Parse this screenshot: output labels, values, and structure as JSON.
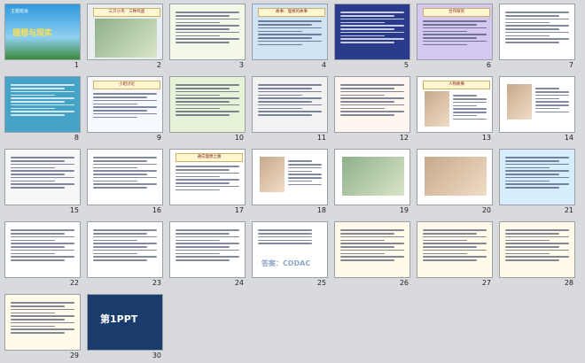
{
  "slides": [
    {
      "n": "1",
      "bg": "#2d8fd0",
      "title": "主题班会",
      "subtitle": "理想与现实",
      "kind": "title"
    },
    {
      "n": "2",
      "bg": "#e9eef2",
      "title": "三只小鸟　三种鸡蛋",
      "kind": "photo"
    },
    {
      "n": "3",
      "bg": "#f4f8e8",
      "title": "",
      "kind": "text"
    },
    {
      "n": "4",
      "bg": "#cfe3f2",
      "title": "故事：理想的故事",
      "kind": "box"
    },
    {
      "n": "5",
      "bg": "#2a3b8c",
      "title": "",
      "kind": "list"
    },
    {
      "n": "6",
      "bg": "#d4c8f0",
      "title": "合作探究",
      "kind": "pink"
    },
    {
      "n": "7",
      "bg": "#ffffff",
      "title": "",
      "kind": "bullets"
    },
    {
      "n": "8",
      "bg": "#46a3c8",
      "title": "",
      "kind": "panel"
    },
    {
      "n": "9",
      "bg": "#f6f9ff",
      "title": "小组讨论",
      "kind": "text"
    },
    {
      "n": "10",
      "bg": "#e6f3d8",
      "title": "",
      "kind": "text"
    },
    {
      "n": "11",
      "bg": "#f2f2f2",
      "title": "",
      "kind": "text"
    },
    {
      "n": "12",
      "bg": "#fff6f0",
      "title": "",
      "kind": "text"
    },
    {
      "n": "13",
      "bg": "#ffffff",
      "title": "人物故事",
      "kind": "person"
    },
    {
      "n": "14",
      "bg": "#ffffff",
      "title": "",
      "kind": "person"
    },
    {
      "n": "15",
      "bg": "#f7f7f7",
      "title": "",
      "kind": "text"
    },
    {
      "n": "16",
      "bg": "#ffffff",
      "title": "",
      "kind": "frame"
    },
    {
      "n": "17",
      "bg": "#ffffff",
      "title": "通向理想之路",
      "kind": "road"
    },
    {
      "n": "18",
      "bg": "#ffffff",
      "title": "",
      "kind": "person"
    },
    {
      "n": "19",
      "bg": "#ffffff",
      "title": "",
      "kind": "photo"
    },
    {
      "n": "20",
      "bg": "#ffffff",
      "title": "",
      "kind": "pic"
    },
    {
      "n": "21",
      "bg": "#d6eefb",
      "title": "",
      "kind": "list"
    },
    {
      "n": "22",
      "bg": "#ffffff",
      "title": "",
      "kind": "text"
    },
    {
      "n": "23",
      "bg": "#ffffff",
      "title": "",
      "kind": "text"
    },
    {
      "n": "24",
      "bg": "#ffffff",
      "title": "",
      "kind": "text"
    },
    {
      "n": "25",
      "bg": "#ffffff",
      "title": "",
      "kind": "answer",
      "answer": "答案：CDDAC"
    },
    {
      "n": "26",
      "bg": "#fffbe8",
      "title": "",
      "kind": "text"
    },
    {
      "n": "27",
      "bg": "#fffbe8",
      "title": "",
      "kind": "text"
    },
    {
      "n": "28",
      "bg": "#fffbe8",
      "title": "",
      "kind": "text"
    },
    {
      "n": "29",
      "bg": "#fffbe8",
      "title": "",
      "kind": "text"
    },
    {
      "n": "30",
      "bg": "#1a3c6c",
      "title": "第1PPT",
      "kind": "logo"
    }
  ]
}
